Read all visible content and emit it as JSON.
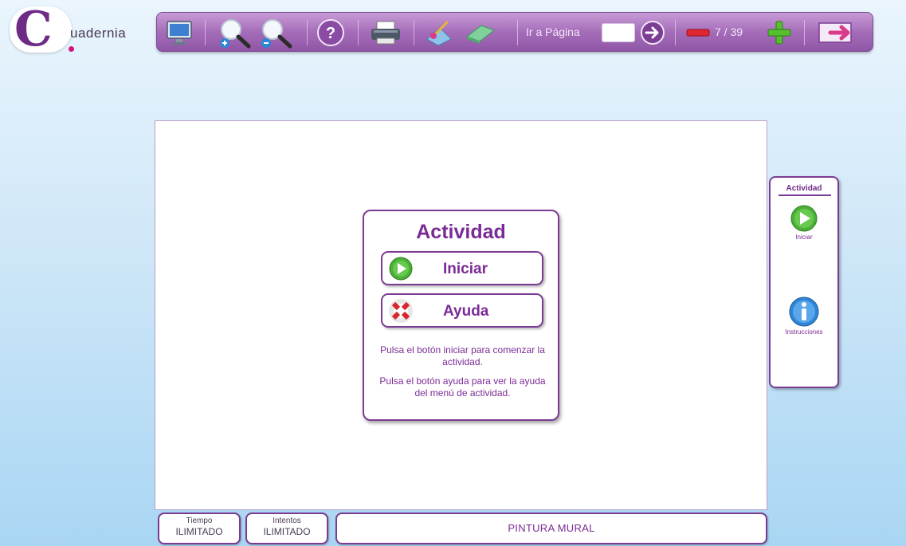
{
  "logo": {
    "letter": "C",
    "name": "uadernia"
  },
  "toolbar": {
    "goto_label": "Ir a Página",
    "goto_value": "",
    "page_current": "7",
    "page_total": "39",
    "page_info": "7 / 39"
  },
  "dialog": {
    "title": "Actividad",
    "start_label": "Iniciar",
    "help_label": "Ayuda",
    "text1": "Pulsa el botón iniciar para comenzar la actividad.",
    "text2": "Pulsa el botón ayuda para ver la ayuda del menú de actividad."
  },
  "side": {
    "title": "Actividad",
    "items": [
      {
        "label": "Iniciar",
        "icon": "play-icon"
      },
      {
        "label": "Instrucciones",
        "icon": "info-icon"
      }
    ]
  },
  "status": {
    "time_key": "Tiempo",
    "time_value": "ILIMITADO",
    "tries_key": "Intentos",
    "tries_value": "ILIMITADO",
    "activity_name": "PINTURA MURAL"
  },
  "colors": {
    "accent": "#7b2b96",
    "toolbar": "#a56db9",
    "background": "#cfe7f8"
  }
}
